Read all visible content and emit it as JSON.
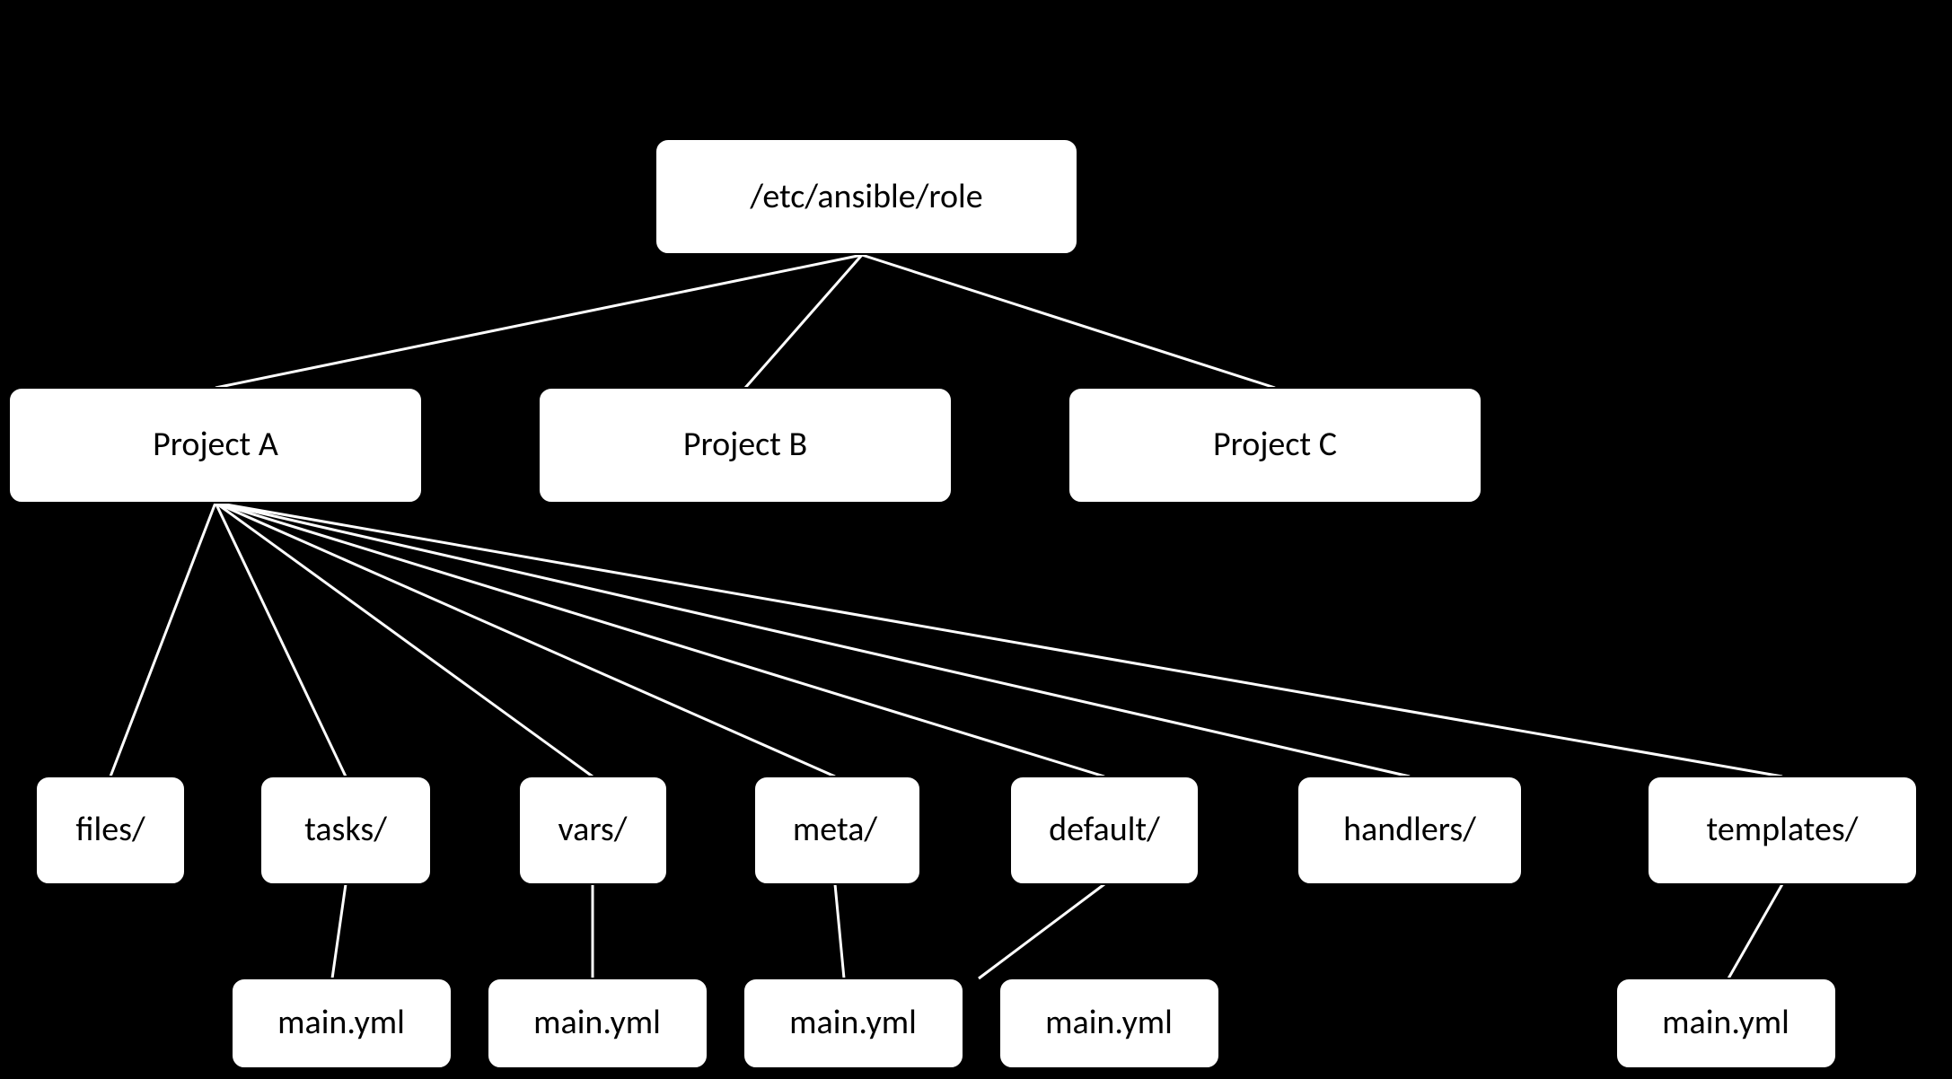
{
  "root": {
    "label": "/etc/ansible/role"
  },
  "projects": [
    {
      "label": "Project A"
    },
    {
      "label": "Project B"
    },
    {
      "label": "Project C"
    }
  ],
  "dirs": [
    {
      "label": "files/"
    },
    {
      "label": "tasks/"
    },
    {
      "label": "vars/"
    },
    {
      "label": "meta/"
    },
    {
      "label": "default/"
    },
    {
      "label": "handlers/"
    },
    {
      "label": "templates/"
    }
  ],
  "files": [
    {
      "label": "main.yml"
    },
    {
      "label": "main.yml"
    },
    {
      "label": "main.yml"
    },
    {
      "label": "main.yml"
    },
    {
      "label": "main.yml"
    }
  ]
}
